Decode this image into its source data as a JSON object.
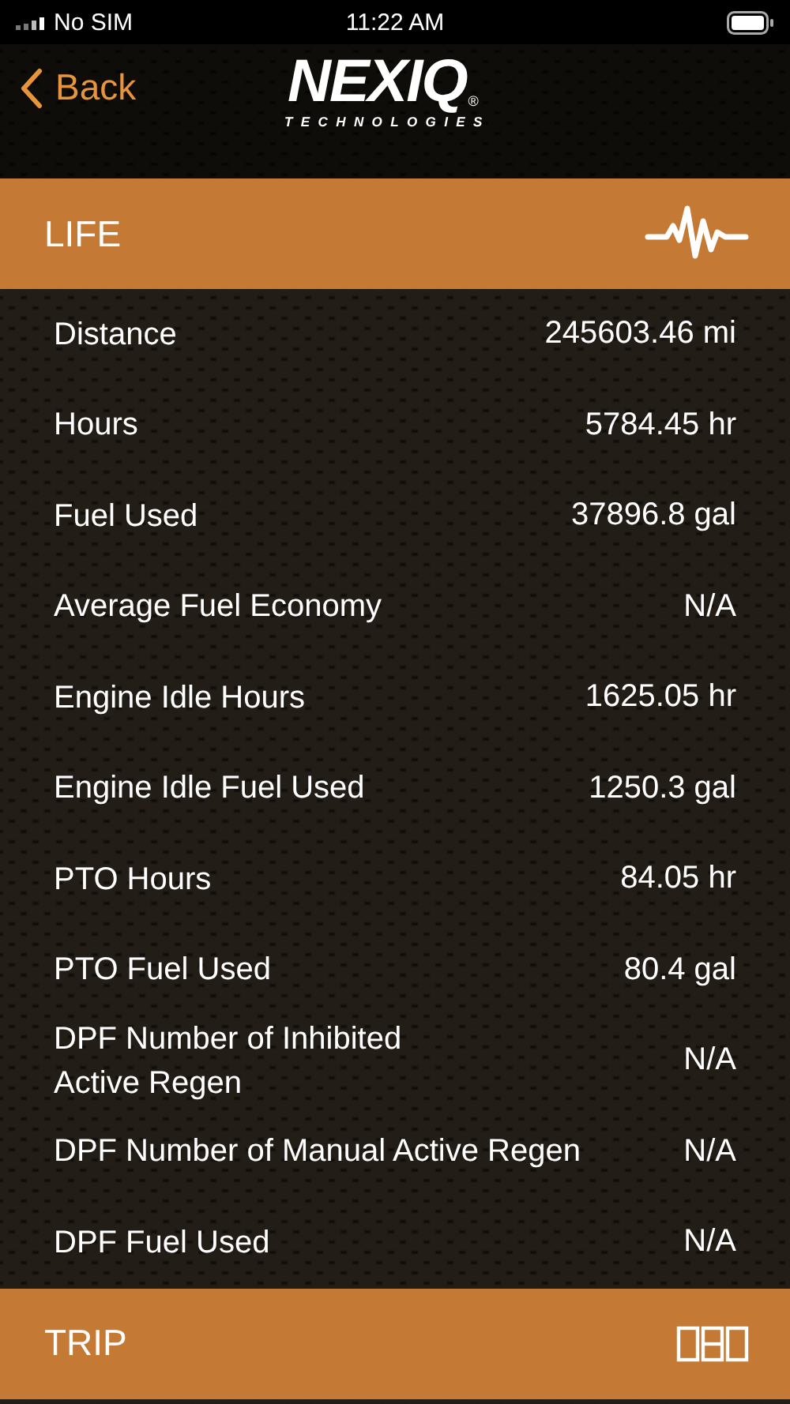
{
  "status_bar": {
    "carrier": "No SIM",
    "time": "11:22 AM"
  },
  "nav": {
    "back": "Back",
    "logo": "NEXIQ",
    "logo_sub": "TECHNOLOGIES",
    "logo_mark": "®"
  },
  "sections": [
    {
      "title": "LIFE",
      "kind": "lifetime",
      "rows": [
        {
          "label": "Distance",
          "value": "245603.46 mi"
        },
        {
          "label": "Hours",
          "value": "5784.45 hr"
        },
        {
          "label": "Fuel Used",
          "value": "37896.8 gal"
        },
        {
          "label": "Average Fuel Economy",
          "value": "N/A"
        },
        {
          "label": "Engine Idle Hours",
          "value": "1625.05 hr"
        },
        {
          "label": "Engine Idle Fuel Used",
          "value": "1250.3 gal"
        },
        {
          "label": "PTO Hours",
          "value": "84.05 hr"
        },
        {
          "label": "PTO Fuel Used",
          "value": "80.4 gal"
        },
        {
          "label": "DPF Number of Inhibited\nActive Regen",
          "value": "N/A"
        },
        {
          "label": "DPF Number of Manual Active Regen",
          "value": "N/A"
        },
        {
          "label": "DPF Fuel Used",
          "value": "N/A"
        }
      ]
    },
    {
      "title": "TRIP",
      "kind": "trip"
    }
  ]
}
